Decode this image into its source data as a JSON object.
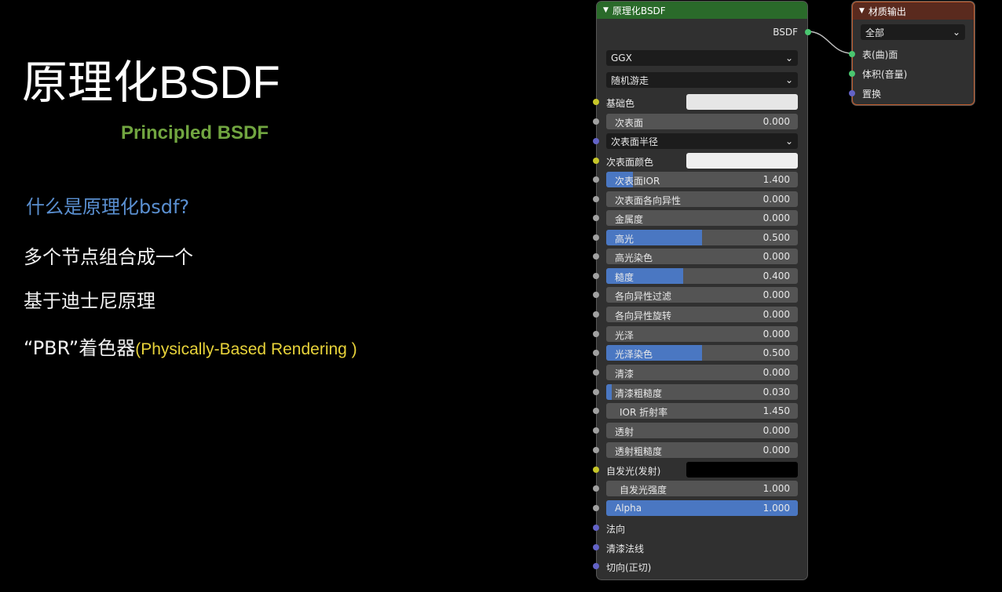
{
  "slide": {
    "title_cjk": "原理化",
    "title_latin": "BSDF",
    "subtitle": "Principled BSDF",
    "question": "什么是原理化bsdf?",
    "bullet1": "多个节点组合成一个",
    "bullet2": "基于迪士尼原理",
    "bullet3_main": "“PBR”着色器",
    "bullet3_note": "(Physically-Based Rendering )"
  },
  "bsdf_node": {
    "title": "原理化BSDF",
    "output_label": "BSDF",
    "distribution": "GGX",
    "subsurface_method": "随机游走",
    "base_color_label": "基础色",
    "base_color": "#e6e6e6",
    "subsurface_radius_label": "次表面半径",
    "subsurface_color_label": "次表面颜色",
    "subsurface_color": "#eeeeee",
    "emission_label": "自发光(发射)",
    "emission_color": "#000000",
    "fields": [
      {
        "label": "次表面",
        "value": "0.000",
        "fill": 0
      },
      {
        "label": "次表面IOR",
        "value": "1.400",
        "fill": 0.14
      },
      {
        "label": "次表面各向异性",
        "value": "0.000",
        "fill": 0
      },
      {
        "label": "金属度",
        "value": "0.000",
        "fill": 0
      },
      {
        "label": "高光",
        "value": "0.500",
        "fill": 0.5
      },
      {
        "label": "高光染色",
        "value": "0.000",
        "fill": 0
      },
      {
        "label": "糙度",
        "value": "0.400",
        "fill": 0.4
      },
      {
        "label": "各向异性过滤",
        "value": "0.000",
        "fill": 0
      },
      {
        "label": "各向异性旋转",
        "value": "0.000",
        "fill": 0
      },
      {
        "label": "光泽",
        "value": "0.000",
        "fill": 0
      },
      {
        "label": "光泽染色",
        "value": "0.500",
        "fill": 0.5
      },
      {
        "label": "清漆",
        "value": "0.000",
        "fill": 0
      },
      {
        "label": "清漆粗糙度",
        "value": "0.030",
        "fill": 0.03
      },
      {
        "label": "IOR 折射率",
        "value": "1.450",
        "fill": 0
      },
      {
        "label": "透射",
        "value": "0.000",
        "fill": 0
      },
      {
        "label": "透射粗糙度",
        "value": "0.000",
        "fill": 0
      },
      {
        "label": "自发光强度",
        "value": "1.000",
        "fill": 0
      },
      {
        "label": "Alpha",
        "value": "1.000",
        "fill": 1
      }
    ],
    "normal_label": "法向",
    "clearcoat_normal_label": "清漆法线",
    "tangent_label": "切向(正切)"
  },
  "output_node": {
    "title": "材质输出",
    "target": "全部",
    "inputs": [
      "表(曲)面",
      "体积(音量)",
      "置换"
    ]
  },
  "colors": {
    "accent_blue": "#4a77c2",
    "subtitle_green": "#71a540",
    "question_blue": "#5a8fd0",
    "note_yellow": "#e8d33a"
  }
}
